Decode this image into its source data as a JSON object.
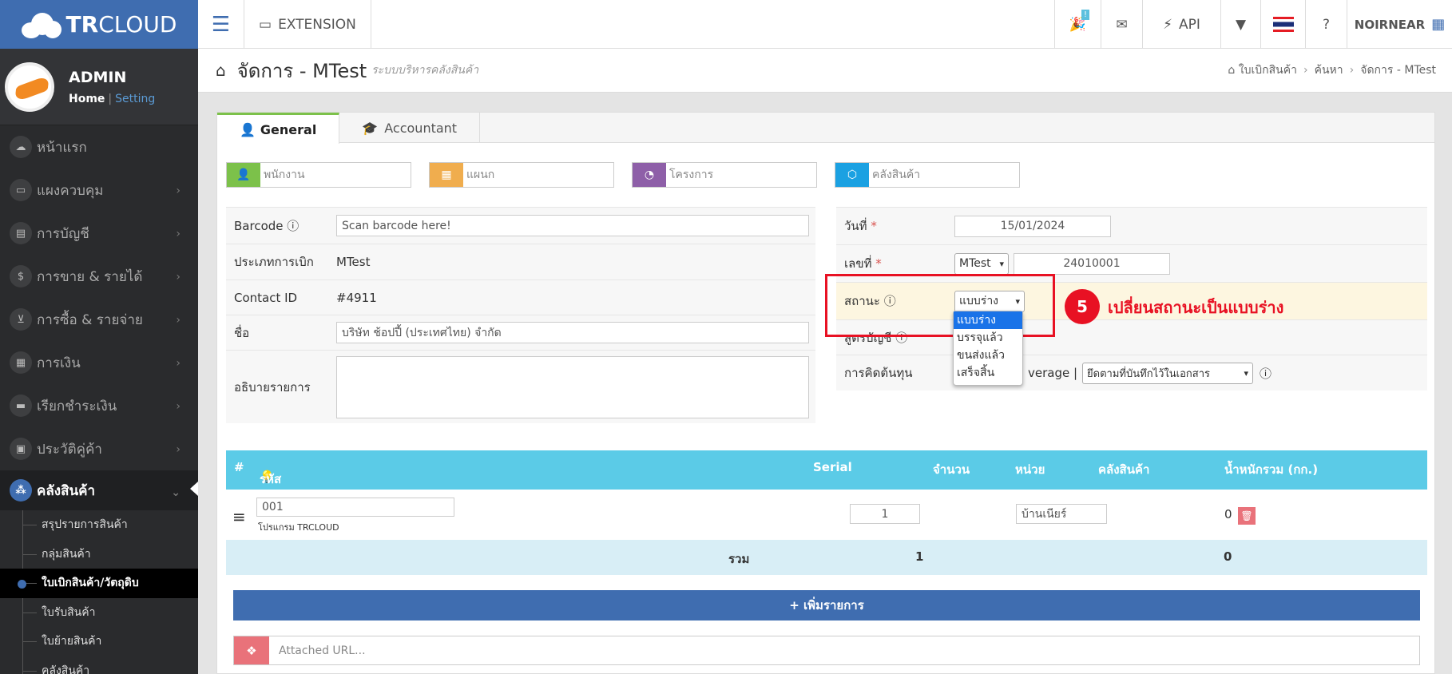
{
  "brand": {
    "bold": "TR",
    "rest": "CLOUD"
  },
  "user": {
    "name": "ADMIN",
    "home": "Home",
    "sep": "|",
    "setting": "Setting"
  },
  "menu": [
    "หน้าแรก",
    "แผงควบคุม",
    "การบัญชี",
    "การขาย & รายได้",
    "การซื้อ & รายจ่าย",
    "การเงิน",
    "เรียกชำระเงิน",
    "ประวัติคู่ค้า",
    "คลังสินค้า"
  ],
  "submenu": [
    "สรุปรายการสินค้า",
    "กลุ่มสินค้า",
    "ใบเบิกสินค้า/วัตถุดิบ",
    "ใบรับสินค้า",
    "ใบย้ายสินค้า",
    "คลังสินค้า"
  ],
  "topbar": {
    "extension": "EXTENSION",
    "badge": "!",
    "api": "API",
    "account": "NOIRNEAR"
  },
  "page": {
    "title": "จัดการ - MTest",
    "subtitle": "ระบบบริหารคลังสินค้า",
    "crumbs": [
      "ใบเบิกสินค้า",
      "ค้นหา",
      "จัดการ - MTest"
    ]
  },
  "tabs": [
    "General",
    "Accountant"
  ],
  "chips": [
    "พนักงาน",
    "แผนก",
    "โครงการ",
    "คลังสินค้า"
  ],
  "form": {
    "barcode_label": "Barcode",
    "barcode_placeholder": "Scan barcode here!",
    "type_label": "ประเภทการเบิก",
    "type_value": "MTest",
    "contact_label": "Contact ID",
    "contact_value": "#4911",
    "name_label": "ชื่อ",
    "name_value": "บริษัท ช้อปปี้ (ประเทศไทย) จำกัด",
    "desc_label": "อธิบายรายการ",
    "date_label": "วันที่",
    "req": "*",
    "date_value": "15/01/2024",
    "no_label": "เลขที่",
    "no_prefix": "MTest",
    "no_value": "24010001",
    "status_label": "สถานะ",
    "status_value": "แบบร่าง",
    "acct_label": "สูตรบัญชี",
    "cost_label": "การคิดต้นทุน",
    "cost_value_a": "verage |",
    "cost_value_b": "ยึดตามที่บันทึกไว้ในเอกสาร"
  },
  "status_options": [
    "แบบร่าง",
    "บรรจุแล้ว",
    "ขนส่งแล้ว",
    "เสร็จสิ้น"
  ],
  "table": {
    "headers": [
      "#",
      "รหัสสินค้า",
      "Serial",
      "จำนวน",
      "หน่วย",
      "คลังสินค้า",
      "น้ำหนักรวม (กก.)"
    ],
    "row": {
      "code": "001",
      "desc": "โปรแกรม TRCLOUD",
      "qty": "1",
      "warehouse": "บ้านเนียร์",
      "weight": "0"
    },
    "sum_label": "รวม",
    "sum_qty": "1",
    "sum_weight": "0",
    "add_label": "+ เพิ่มรายการ",
    "url_placeholder": "Attached URL..."
  },
  "annotation": {
    "step": "5",
    "text": "เปลี่ยนสถานะเป็นแบบร่าง"
  }
}
